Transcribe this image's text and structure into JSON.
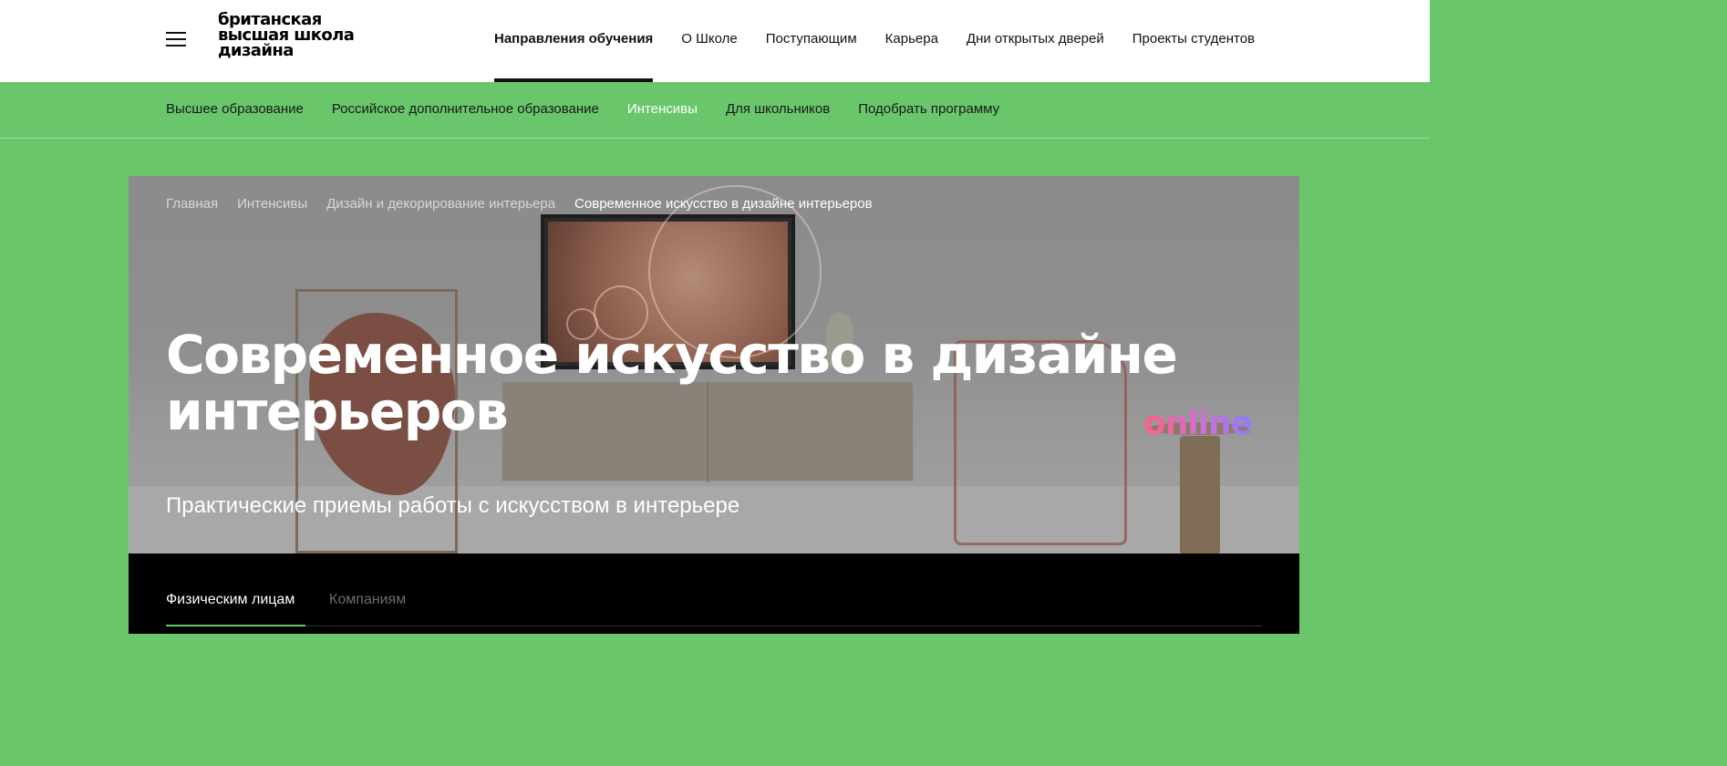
{
  "header": {
    "logo_lines": [
      "британская",
      "высшая школа",
      "дизайна"
    ],
    "nav": [
      {
        "label": "Направления обучения",
        "active": true
      },
      {
        "label": "О Школе",
        "active": false
      },
      {
        "label": "Поступающим",
        "active": false
      },
      {
        "label": "Карьера",
        "active": false
      },
      {
        "label": "Дни открытых дверей",
        "active": false
      },
      {
        "label": "Проекты студентов",
        "active": false
      }
    ]
  },
  "subnav": {
    "items": [
      {
        "label": "Высшее образование",
        "active": false
      },
      {
        "label": "Российское дополнительное образование",
        "active": false
      },
      {
        "label": "Интенсивы",
        "active": true
      },
      {
        "label": "Для школьников",
        "active": false
      },
      {
        "label": "Подобрать программу",
        "active": false
      }
    ]
  },
  "hero": {
    "breadcrumb": [
      "Главная",
      "Интенсивы",
      "Дизайн и декорирование интерьера",
      "Современное искусство в дизайне интерьеров"
    ],
    "title_lines": [
      "Современное искусство в дизайне",
      "интерьеров"
    ],
    "badge": "online",
    "subtitle": "Практические приемы работы с искусством в интерьере"
  },
  "tabs": [
    {
      "label": "Физическим лицам",
      "active": true
    },
    {
      "label": "Компаниям",
      "active": false
    }
  ],
  "colors": {
    "brand_green": "#69c66b",
    "hero_overlay": "#8b8b8b",
    "tab_panel": "#000000",
    "badge_gradient": [
      "#ff5f86",
      "#d36fd1",
      "#8c7bff"
    ]
  },
  "icons": {
    "menu": "hamburger-menu-icon"
  }
}
